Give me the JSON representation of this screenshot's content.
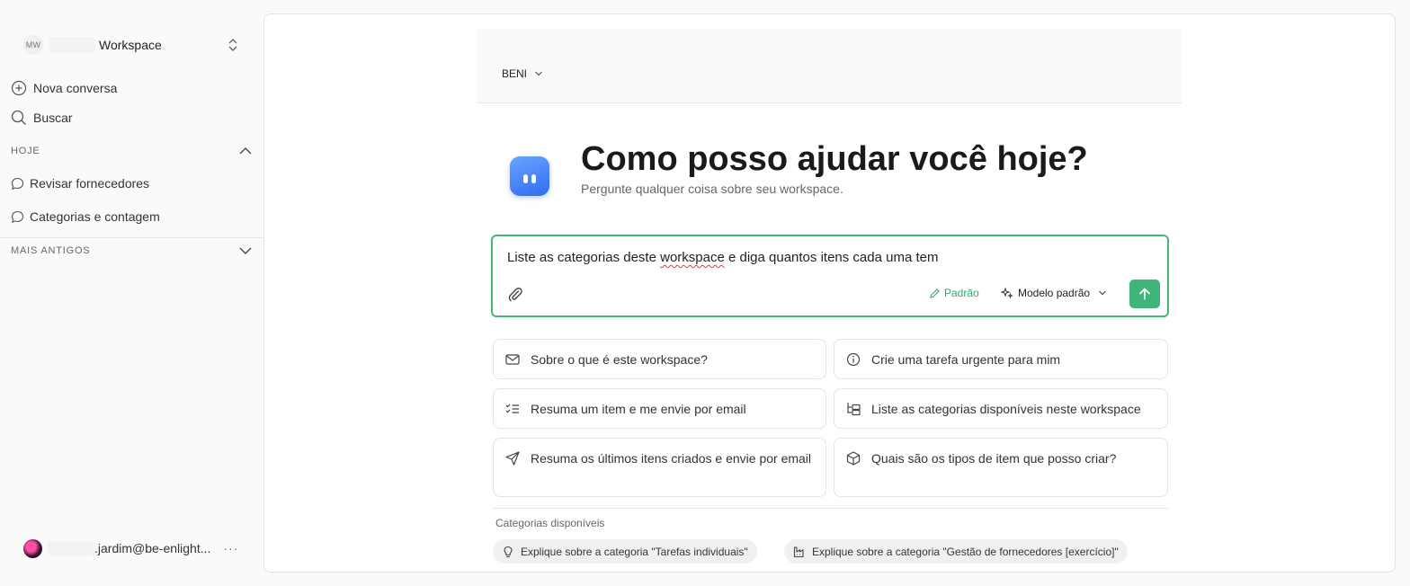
{
  "sidebar": {
    "workspace": {
      "initials": "MW",
      "name": "Workspace"
    },
    "actions": {
      "new_chat": "Nova conversa",
      "search": "Buscar"
    },
    "sections": {
      "today": "HOJE",
      "older": "MAIS ANTIGOS"
    },
    "today_items": [
      "Revisar fornecedores",
      "Categorias e contagem"
    ],
    "user": {
      "email": ".jardim@be-enlight...",
      "more": "···"
    }
  },
  "header": {
    "agent": "BENI"
  },
  "hero": {
    "title": "Como posso ajudar você hoje?",
    "subtitle": "Pergunte qualquer coisa sobre seu workspace."
  },
  "composer": {
    "text_before": "Liste as categorias deste ",
    "text_flagged": "workspace",
    "text_after": " e diga quantos itens cada uma tem",
    "mode": "Padrão",
    "model": "Modelo padrão"
  },
  "suggestions": [
    "Sobre o que é este workspace?",
    "Crie uma tarefa urgente para mim",
    "Resuma um item e me envie por email",
    "Liste as categorias disponíveis neste workspace",
    "Resuma os últimos itens criados e envie por email",
    "Quais são os tipos de item que posso criar?"
  ],
  "categories": {
    "label": "Categorias disponíveis",
    "chips": [
      "Explique sobre a categoria \"Tarefas individuais\"",
      "Explique sobre a categoria \"Gestão de fornecedores [exercício]\""
    ]
  },
  "colors": {
    "accent_green": "#3fb47a",
    "logo_blue": "#2f6df0"
  }
}
